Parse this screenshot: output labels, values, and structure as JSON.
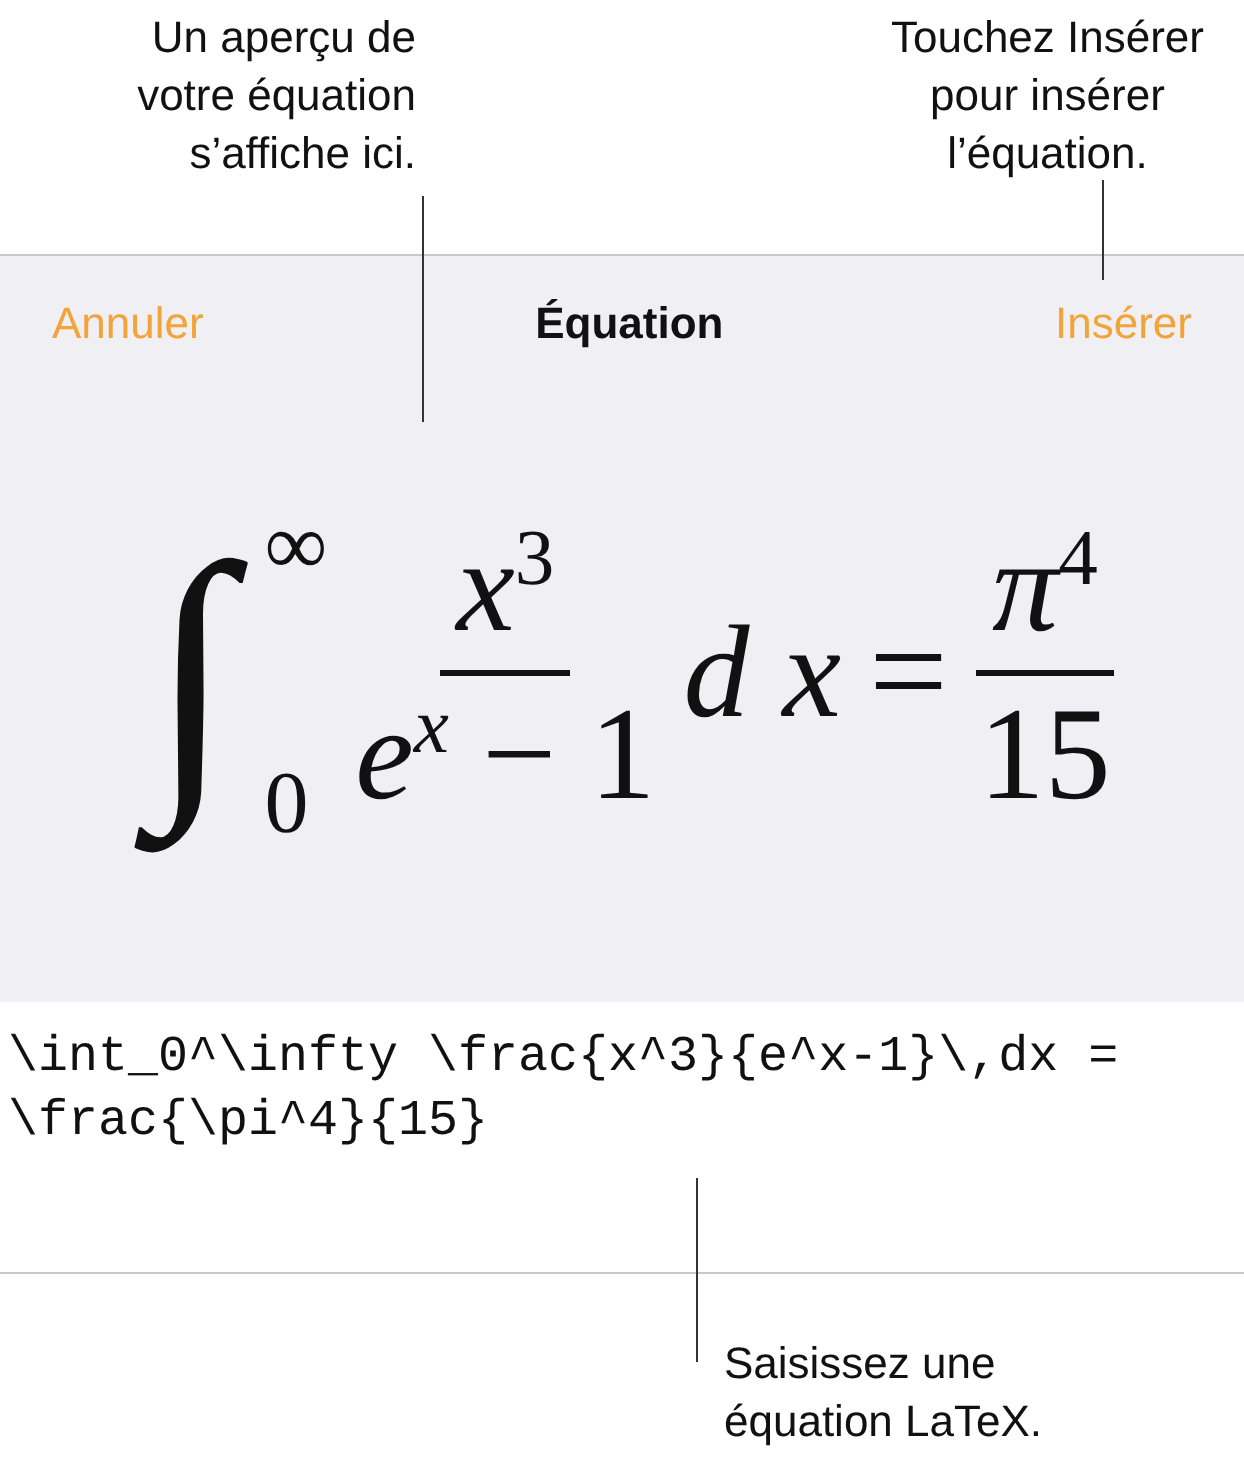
{
  "callouts": [
    {
      "text": "Un aperçu de\nvotre équation\ns’affiche ici."
    },
    {
      "text": "Touchez Insérer\npour insérer\nl’équation."
    },
    {
      "text": "Saisissez une\néquation LaTeX."
    }
  ],
  "nav": {
    "cancel": "Annuler",
    "title": "Équation",
    "insert": "Insérer"
  },
  "preview": {
    "integral": "∫",
    "upper": "∞",
    "lower": "0",
    "numerator": "*x*$^{3}$",
    "denominator": "*e*$^{x}$ − 1",
    "differential": "*d x*",
    "equals": "=",
    "rhs_numerator": "*π*$^{4}$",
    "rhs_denominator": "15"
  },
  "latex_field": {
    "value": "\\int_0^\\infty \\frac{x^3}{e^x-1}\\,dx = \\frac{\\pi^4}{15}"
  }
}
